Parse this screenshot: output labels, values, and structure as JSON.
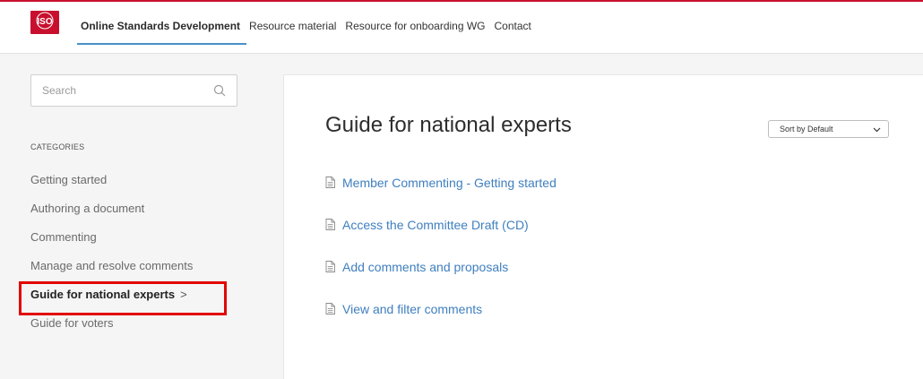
{
  "header": {
    "logo_text": "ISO",
    "nav": [
      {
        "label": "Online Standards Development",
        "active": true
      },
      {
        "label": "Resource material",
        "active": false
      },
      {
        "label": "Resource for onboarding WG",
        "active": false
      },
      {
        "label": "Contact",
        "active": false
      }
    ]
  },
  "sidebar": {
    "search_placeholder": "Search",
    "categories_heading": "CATEGORIES",
    "categories": [
      {
        "label": "Getting started"
      },
      {
        "label": "Authoring a document"
      },
      {
        "label": "Commenting"
      },
      {
        "label": "Manage and resolve comments"
      },
      {
        "label": "Guide for national experts"
      },
      {
        "label": "Guide for voters"
      }
    ],
    "selected_chevron": ">"
  },
  "main": {
    "title": "Guide for national experts",
    "sort_label": "Sort by Default",
    "articles": [
      {
        "label": "Member Commenting - Getting started"
      },
      {
        "label": "Access the Committee Draft (CD)"
      },
      {
        "label": "Add comments and proposals"
      },
      {
        "label": "View and filter comments"
      }
    ]
  },
  "colors": {
    "brand_red": "#c8102e",
    "link_blue": "#3f7fbf",
    "highlight_red": "#e10600",
    "nav_underline": "#4a90c8"
  },
  "icons": {
    "search": "search-icon",
    "document": "document-icon",
    "chevron": "chevron-down-icon"
  }
}
